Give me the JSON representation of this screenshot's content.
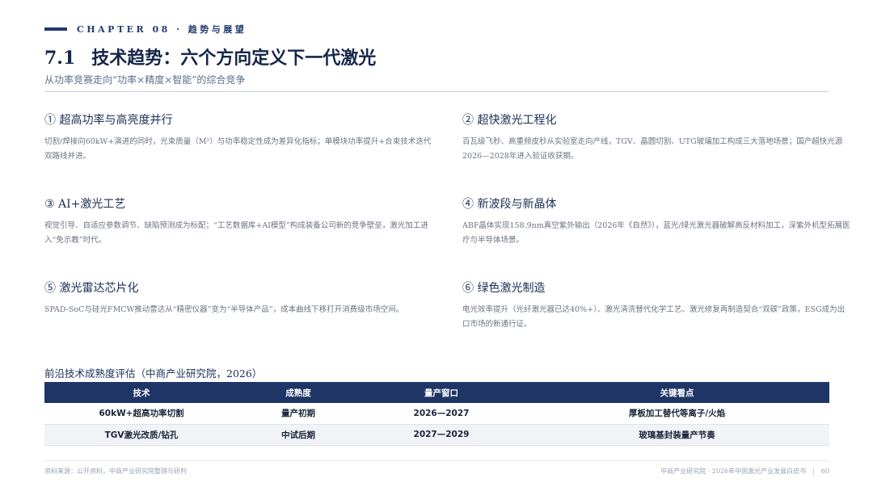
{
  "header": {
    "chapter": "CHAPTER 08 · 趋势与展望",
    "section_number": "7.1",
    "title": "技术趋势：六个方向定义下一代激光",
    "subtitle": "从功率竞赛走向“功率×精度×智能”的综合竞争"
  },
  "trends": [
    {
      "heading": "① 超高功率与高亮度并行",
      "body": "切割/焊接向60kW+演进的同时，光束质量（M²）与功率稳定性成为差异化指标；单模块功率提升+合束技术迭代双路线并进。"
    },
    {
      "heading": "② 超快激光工程化",
      "body": "百瓦级飞秒、高重频皮秒从实验室走向产线，TGV、晶圆切割、UTG玻璃加工构成三大落地场景；国产超快光源2026—2028年进入验证收获期。"
    },
    {
      "heading": "③ AI+激光工艺",
      "body": "视觉引导、自适应参数调节、缺陷预测成为标配；“工艺数据库+AI模型”构成装备公司新的竞争壁垒，激光加工进入“免示教”时代。"
    },
    {
      "heading": "④ 新波段与新晶体",
      "body": "ABF晶体实现158.9nm真空紫外输出（2026年《自然》），蓝光/绿光激光器破解高反材料加工，深紫外机型拓展医疗与半导体场景。"
    },
    {
      "heading": "⑤ 激光雷达芯片化",
      "body": "SPAD-SoC与硅光FMCW推动雷达从“精密仪器”变为“半导体产品”，成本曲线下移打开消费级市场空间。"
    },
    {
      "heading": "⑥ 绿色激光制造",
      "body": "电光效率提升（光纤激光器已达40%+）、激光清洗替代化学工艺、激光修复再制造契合“双碳”政策，ESG成为出口市场的新通行证。"
    }
  ],
  "table": {
    "caption": "前沿技术成熟度评估（中商产业研究院，2026）",
    "headers": [
      "技术",
      "成熟度",
      "量产窗口",
      "关键看点"
    ],
    "rows": [
      [
        "60kW+超高功率切割",
        "量产初期",
        "2026—2027",
        "厚板加工替代等离子/火焰"
      ],
      [
        "TGV激光改质/钻孔",
        "中试后期",
        "2027—2029",
        "玻璃基封装量产节奏"
      ]
    ]
  },
  "footer": {
    "source": "资料来源：公开资料，中商产业研究院整理与研判",
    "publisher": "中商产业研究院 · 2026年中国激光产业发展白皮书",
    "page": "60"
  }
}
